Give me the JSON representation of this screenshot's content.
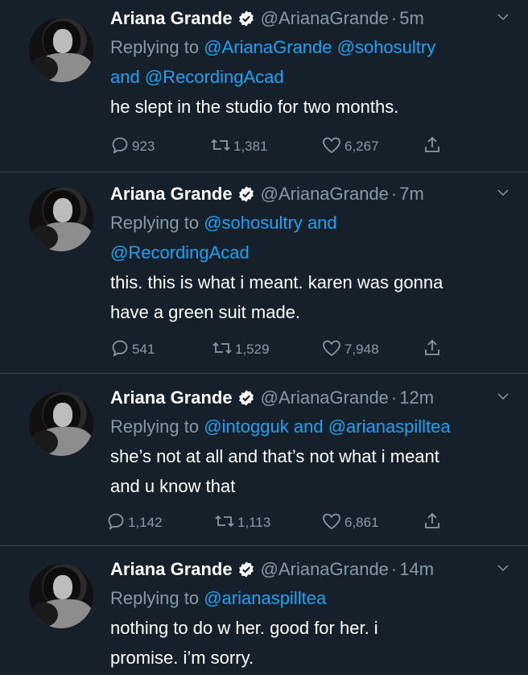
{
  "tweets": [
    {
      "name": "Ariana Grande",
      "handle": "@ArianaGrande",
      "time": "5m",
      "replying_prefix": "Replying to",
      "replying_line1": "@ArianaGrande @sohosultry",
      "replying_and": "and",
      "replying_line2": "@RecordingAcad",
      "text_lines": [
        "he slept in the studio for two months."
      ],
      "replies": "923",
      "retweets": "1,381",
      "likes": "6,267"
    },
    {
      "name": "Ariana Grande",
      "handle": "@ArianaGrande",
      "time": "7m",
      "replying_prefix": "Replying to",
      "replying_line1": "@sohosultry",
      "replying_and": "and",
      "replying_line2": "@RecordingAcad",
      "text_lines": [
        "this. this is what i meant. karen was gonna",
        "have a green suit made."
      ],
      "replies": "541",
      "retweets": "1,529",
      "likes": "7,948"
    },
    {
      "name": "Ariana Grande",
      "handle": "@ArianaGrande",
      "time": "12m",
      "replying_prefix": "Replying to",
      "replying_line1": "@intogguk",
      "replying_and": "and",
      "replying_line2": "@arianaspilltea",
      "text_lines": [
        "she’s not at all and that’s not what i meant",
        "and u know that"
      ],
      "replies": "1,142",
      "retweets": "1,113",
      "likes": "6,861"
    },
    {
      "name": "Ariana Grande",
      "handle": "@ArianaGrande",
      "time": "14m",
      "replying_prefix": "Replying to",
      "replying_line1": "@arianaspilltea",
      "text_lines": [
        "nothing to do w her. good for her. i",
        "promise. i’m sorry."
      ]
    }
  ],
  "icons": {
    "verified": "verified-badge-icon",
    "more": "chevron-down-icon",
    "reply": "reply-icon",
    "retweet": "retweet-icon",
    "like": "heart-icon",
    "share": "share-icon"
  },
  "colors": {
    "background": "#15202b",
    "secondary_text": "#8899a6",
    "link": "#1da1f2",
    "divider": "#38444d"
  }
}
